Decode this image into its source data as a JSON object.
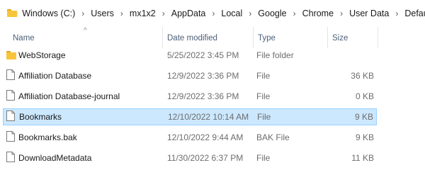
{
  "breadcrumb": {
    "overflow": "«",
    "items": [
      "Windows (C:)",
      "Users",
      "mx1x2",
      "AppData",
      "Local",
      "Google",
      "Chrome",
      "User Data",
      "Default"
    ],
    "separator": "›"
  },
  "columns": {
    "name": "Name",
    "date": "Date modified",
    "type": "Type",
    "size": "Size",
    "sort_indicator": "^"
  },
  "files": [
    {
      "name": "WebStorage",
      "date": "5/25/2022 3:45 PM",
      "type": "File folder",
      "size": "",
      "icon": "folder-icon",
      "selected": false
    },
    {
      "name": "Affiliation Database",
      "date": "12/9/2022 3:36 PM",
      "type": "File",
      "size": "36 KB",
      "icon": "file-icon",
      "selected": false
    },
    {
      "name": "Affiliation Database-journal",
      "date": "12/9/2022 3:36 PM",
      "type": "File",
      "size": "0 KB",
      "icon": "file-icon",
      "selected": false
    },
    {
      "name": "Bookmarks",
      "date": "12/10/2022 10:14 AM",
      "type": "File",
      "size": "9 KB",
      "icon": "file-icon",
      "selected": true
    },
    {
      "name": "Bookmarks.bak",
      "date": "12/10/2022 9:44 AM",
      "type": "BAK File",
      "size": "9 KB",
      "icon": "file-icon",
      "selected": false
    },
    {
      "name": "DownloadMetadata",
      "date": "11/30/2022 6:37 PM",
      "type": "File",
      "size": "11 KB",
      "icon": "file-icon",
      "selected": false
    }
  ],
  "colors": {
    "folder": "#f8c53a",
    "selection_bg": "#cce8ff",
    "selection_border": "#99d1ff",
    "header_text": "#4c607a"
  }
}
